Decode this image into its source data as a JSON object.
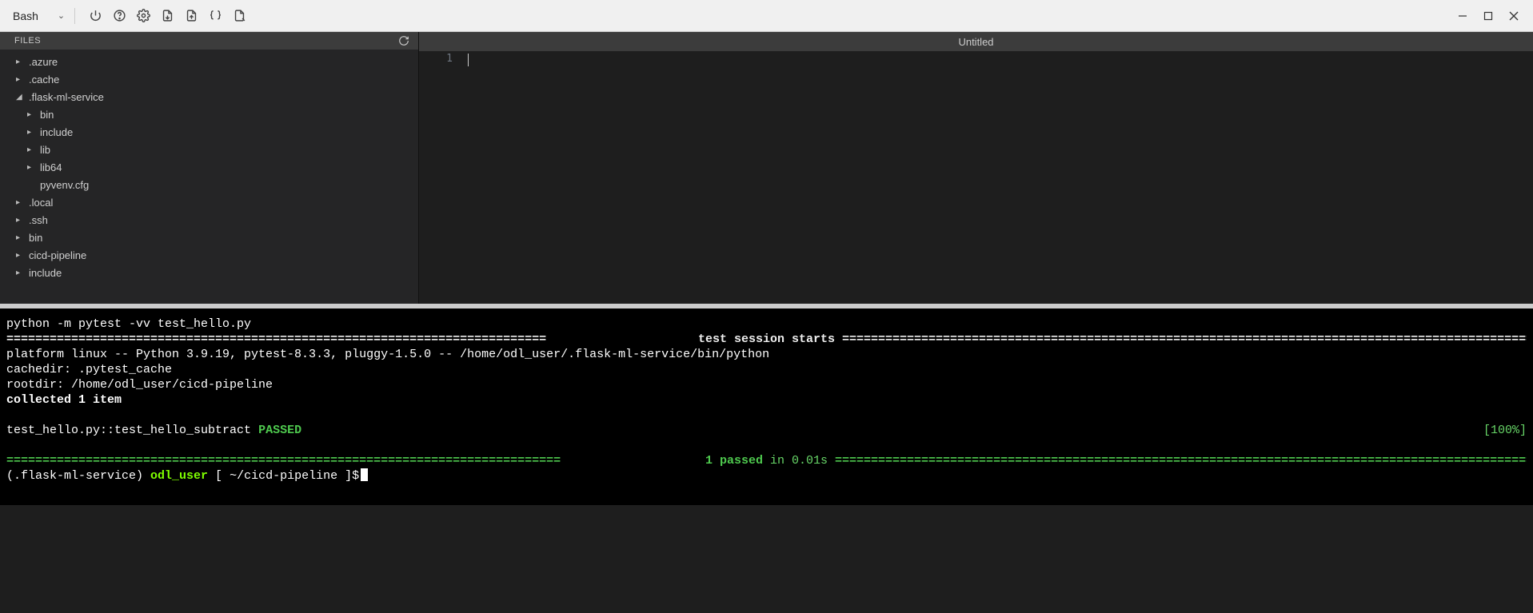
{
  "toolbar": {
    "shell_label": "Bash"
  },
  "sidebar": {
    "header": "FILES",
    "tree": [
      {
        "label": ".azure",
        "depth": 0,
        "expanded": false,
        "type": "folder"
      },
      {
        "label": ".cache",
        "depth": 0,
        "expanded": false,
        "type": "folder"
      },
      {
        "label": ".flask-ml-service",
        "depth": 0,
        "expanded": true,
        "type": "folder"
      },
      {
        "label": "bin",
        "depth": 1,
        "expanded": false,
        "type": "folder"
      },
      {
        "label": "include",
        "depth": 1,
        "expanded": false,
        "type": "folder"
      },
      {
        "label": "lib",
        "depth": 1,
        "expanded": false,
        "type": "folder"
      },
      {
        "label": "lib64",
        "depth": 1,
        "expanded": false,
        "type": "folder"
      },
      {
        "label": "pyvenv.cfg",
        "depth": 1,
        "expanded": false,
        "type": "file"
      },
      {
        "label": ".local",
        "depth": 0,
        "expanded": false,
        "type": "folder"
      },
      {
        "label": ".ssh",
        "depth": 0,
        "expanded": false,
        "type": "folder"
      },
      {
        "label": "bin",
        "depth": 0,
        "expanded": false,
        "type": "folder"
      },
      {
        "label": "cicd-pipeline",
        "depth": 0,
        "expanded": false,
        "type": "folder"
      },
      {
        "label": "include",
        "depth": 0,
        "expanded": false,
        "type": "folder"
      }
    ]
  },
  "editor": {
    "tab_title": "Untitled",
    "line_number": "1"
  },
  "terminal": {
    "cmd": "python -m pytest -vv test_hello.py",
    "session_header": " test session starts ",
    "platform_line": "platform linux -- Python 3.9.19, pytest-8.3.3, pluggy-1.5.0 -- /home/odl_user/.flask-ml-service/bin/python",
    "cachedir_line": "cachedir: .pytest_cache",
    "rootdir_line": "rootdir: /home/odl_user/cicd-pipeline",
    "collected_line": "collected 1 item",
    "test_id": "test_hello.py::test_hello_subtract",
    "test_result": "PASSED",
    "test_pct": "[100%]",
    "summary_passed": "1 passed",
    "summary_time": " in 0.01s",
    "prompt_venv": "(.flask-ml-service) ",
    "prompt_user": "odl_user ",
    "prompt_open": "[ ",
    "prompt_path": "~/cicd-pipeline ",
    "prompt_close": "]$"
  }
}
